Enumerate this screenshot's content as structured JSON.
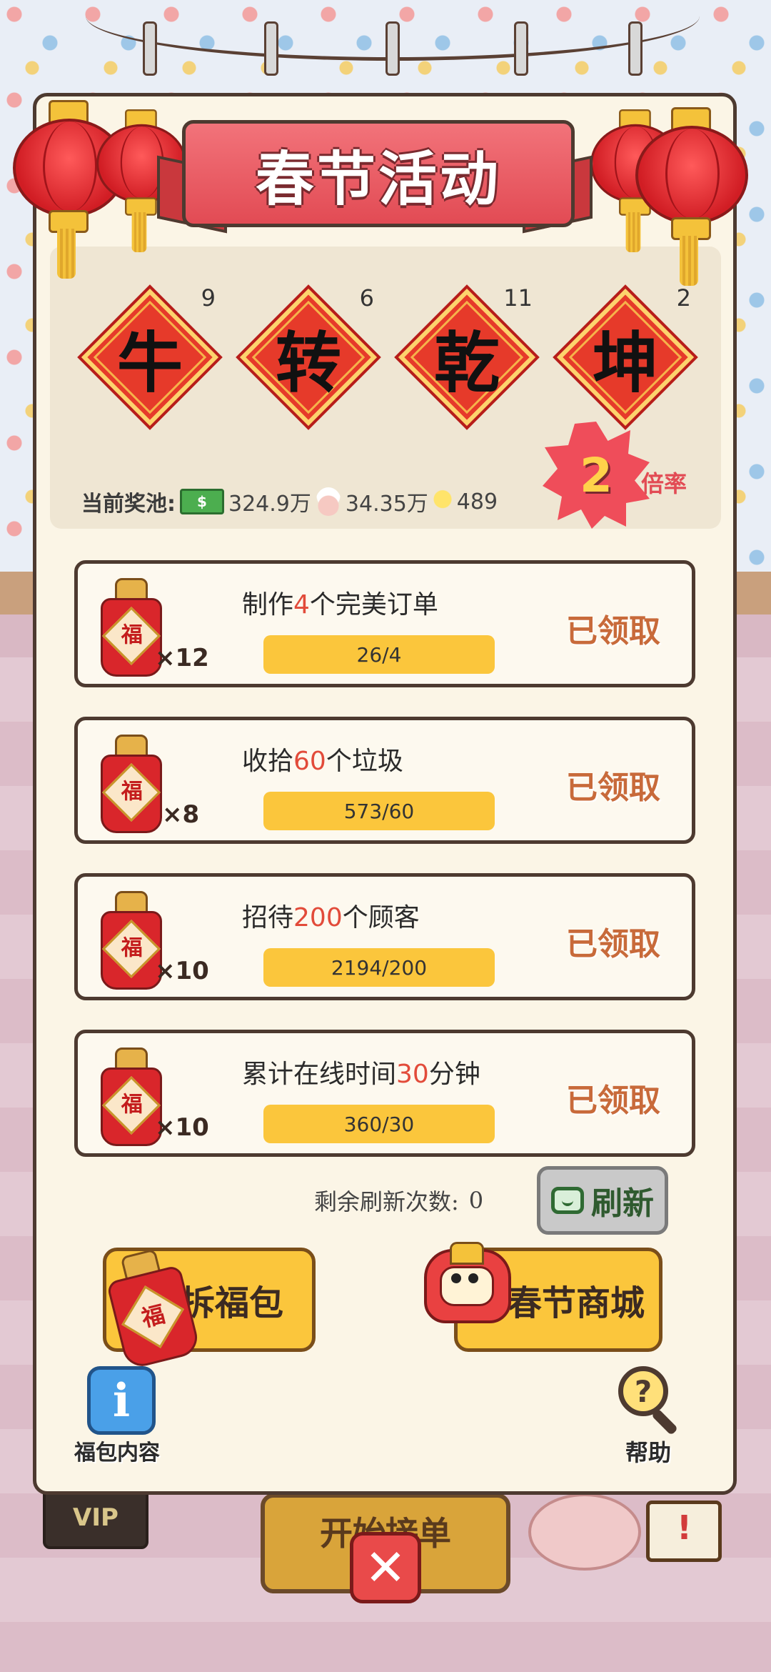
{
  "title": "春节活动",
  "cards": [
    {
      "char": "牛",
      "count": "9"
    },
    {
      "char": "转",
      "count": "6"
    },
    {
      "char": "乾",
      "count": "11"
    },
    {
      "char": "坤",
      "count": "2"
    }
  ],
  "multiplier": {
    "value": "2",
    "label": "倍率"
  },
  "pool": {
    "label": "当前奖池:",
    "money": "324.9万",
    "chefs": "34.35万",
    "bulbs": "489"
  },
  "tasks": [
    {
      "pre": "制作",
      "num": "4",
      "post": "个完美订单",
      "progress": "26/4",
      "reward": "×12",
      "status": "已领取"
    },
    {
      "pre": "收拾",
      "num": "60",
      "post": "个垃圾",
      "progress": "573/60",
      "reward": "×8",
      "status": "已领取"
    },
    {
      "pre": "招待",
      "num": "200",
      "post": "个顾客",
      "progress": "2194/200",
      "reward": "×10",
      "status": "已领取"
    },
    {
      "pre": "累计在线时间",
      "num": "30",
      "post": "分钟",
      "progress": "360/30",
      "reward": "×10",
      "status": "已领取"
    }
  ],
  "refresh": {
    "label": "剩余刷新次数:",
    "count": "0",
    "button": "刷新"
  },
  "bag_char": "福",
  "buttons": {
    "open": "拆福包",
    "shop": "春节商城"
  },
  "info": {
    "label": "福包内容"
  },
  "help": {
    "label": "帮助"
  },
  "background": {
    "vip": "VIP",
    "start": "开始接单"
  },
  "colors": {
    "accent": "#e24b54",
    "button": "#fbc63c",
    "panel": "#fbf5e6"
  },
  "icons": [
    "lantern-icon",
    "money-icon",
    "chef-icon",
    "bulb-icon",
    "lucky-bag-icon",
    "tv-icon",
    "lion-dance-icon",
    "info-icon",
    "help-magnifier-icon",
    "close-icon"
  ]
}
